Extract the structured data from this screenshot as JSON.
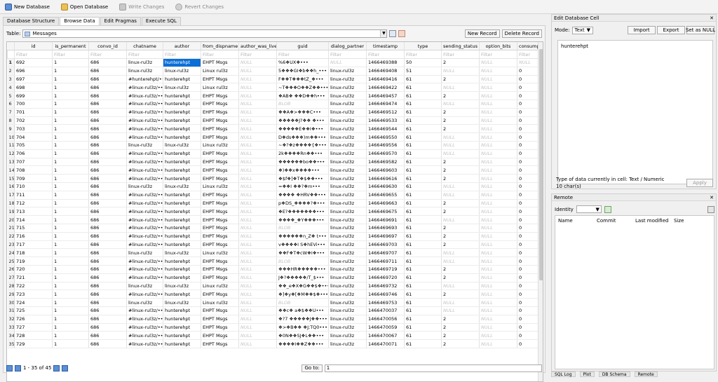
{
  "toolbar": {
    "new_db": "New Database",
    "open_db": "Open Database",
    "write": "Write Changes",
    "revert": "Revert Changes"
  },
  "tabs": [
    "Database Structure",
    "Browse Data",
    "Edit Pragmas",
    "Execute SQL"
  ],
  "browse": {
    "table_label": "Table:",
    "table_name": "Messages",
    "new_record": "New Record",
    "delete_record": "Delete Record",
    "filter_placeholder": "Filter",
    "columns": [
      "id",
      "is_permanent",
      "convo_id",
      "chatname",
      "author",
      "from_dispname",
      "author_was_live",
      "guid",
      "dialog_partner",
      "timestamp",
      "type",
      "sending_status",
      "option_bits",
      "consumpt"
    ],
    "rows": [
      [
        "1",
        "692",
        "1",
        "686",
        "linux-rul3z",
        "hunterehpt",
        "EHPT Msgs",
        "NULL",
        "%6❖UX❖•••",
        "NULL",
        "1466469388",
        "50",
        "2",
        "NULL",
        "NULL"
      ],
      [
        "2",
        "696",
        "1",
        "686",
        "linux-rul3z",
        "linux-rul3z",
        "Linux rul3z",
        "NULL",
        "5❖❖❖GI❖b❖❖h_•••",
        "linux-rul3z",
        "1466469408",
        "51",
        "NULL",
        "NULL",
        "0"
      ],
      [
        "3",
        "697",
        "1",
        "686",
        "#hunterehpt/•••",
        "hunterehpt",
        "EHPT Msgs",
        "NULL",
        "F❖❖T❖❖❖tZ_❖•••",
        "linux-rul3z",
        "1466469416",
        "61",
        "2",
        "NULL",
        "0"
      ],
      [
        "4",
        "698",
        "1",
        "686",
        "#linux-rul3z/•••",
        "linux-rul3z",
        "Linux rul3z",
        "NULL",
        "~T❖❖❖O❖❖Z❖❖•••",
        "linux-rul3z",
        "1466469422",
        "61",
        "NULL",
        "NULL",
        "0"
      ],
      [
        "5",
        "699",
        "1",
        "686",
        "#linux-rul3z/•••",
        "hunterehpt",
        "EHPT Msgs",
        "NULL",
        "❖AB❖ ❖❖D❖❖h•••",
        "linux-rul3z",
        "1466469457",
        "61",
        "2",
        "NULL",
        "0"
      ],
      [
        "6",
        "700",
        "1",
        "686",
        "#linux-rul3z/•••",
        "hunterehpt",
        "EHPT Msgs",
        "NULL",
        "BLOB",
        "linux-rul3z",
        "1466469474",
        "61",
        "NULL",
        "NULL",
        "0"
      ],
      [
        "7",
        "701",
        "1",
        "686",
        "#linux-rul3z/•••",
        "hunterehpt",
        "EHPT Msgs",
        "NULL",
        "❖❖A❖>❖❖❖C•••",
        "linux-rul3z",
        "1466469512",
        "61",
        "2",
        "NULL",
        "0"
      ],
      [
        "8",
        "702",
        "1",
        "686",
        "#linux-rul3z/•••",
        "hunterehpt",
        "EHPT Msgs",
        "NULL",
        "❖❖❖❖❖J?❖❖ ❖•••",
        "linux-rul3z",
        "1466469533",
        "61",
        "2",
        "NULL",
        "0"
      ],
      [
        "9",
        "703",
        "1",
        "686",
        "#linux-rul3z/•••",
        "hunterehpt",
        "EHPT Msgs",
        "NULL",
        "❖❖❖❖❖E❖❖I❖•••",
        "linux-rul3z",
        "1466469544",
        "61",
        "2",
        "NULL",
        "0"
      ],
      [
        "10",
        "704",
        "1",
        "686",
        "#linux-rul3z/•••",
        "hunterehpt",
        "EHPT Msgs",
        "NULL",
        "D❖ds❖❖❖)m❖❖•••",
        "linux-rul3z",
        "1466469550",
        "61",
        "NULL",
        "NULL",
        "0"
      ],
      [
        "11",
        "705",
        "1",
        "686",
        "linux-rul3z",
        "linux-rul3z",
        "Linux rul3z",
        "NULL",
        "~❖?❖z❖❖❖❖{❖•••",
        "linux-rul3z",
        "1466469556",
        "61",
        "NULL",
        "NULL",
        "0"
      ],
      [
        "12",
        "706",
        "1",
        "686",
        "#linux-rul3z/•••",
        "hunterehpt",
        "EHPT Msgs",
        "NULL",
        "2k❖❖❖❖Rn❖❖•••",
        "linux-rul3z",
        "1466469570",
        "61",
        "NULL",
        "NULL",
        "0"
      ],
      [
        "13",
        "707",
        "1",
        "686",
        "#linux-rul3z/•••",
        "hunterehpt",
        "EHPT Msgs",
        "NULL",
        "❖❖❖❖❖❖bo❖❖•••",
        "linux-rul3z",
        "1466469582",
        "61",
        "2",
        "NULL",
        "0"
      ],
      [
        "14",
        "708",
        "1",
        "686",
        "#linux-rul3z/•••",
        "hunterehpt",
        "EHPT Msgs",
        "NULL",
        "❖)❖❖x❖❖❖❖•••",
        "linux-rul3z",
        "1466469603",
        "61",
        "2",
        "NULL",
        "0"
      ],
      [
        "15",
        "709",
        "1",
        "686",
        "#linux-rul3z/•••",
        "hunterehpt",
        "EHPT Msgs",
        "NULL",
        "❖$f❖]❖T❖$❖❖•••",
        "linux-rul3z",
        "1466469616",
        "61",
        "2",
        "NULL",
        "0"
      ],
      [
        "16",
        "710",
        "1",
        "686",
        "linux-rul3z",
        "linux-rul3z",
        "Linux rul3z",
        "NULL",
        "=❖❖I ❖❖?❖m•••",
        "linux-rul3z",
        "1466469630",
        "61",
        "NULL",
        "NULL",
        "0"
      ],
      [
        "17",
        "711",
        "1",
        "686",
        "#linux-rul3z/•••",
        "hunterehpt",
        "EHPT Msgs",
        "NULL",
        "❖❖❖❖ ❖HRV❖❖•••",
        "linux-rul3z",
        "1466469655",
        "61",
        "NULL",
        "NULL",
        "0"
      ],
      [
        "18",
        "712",
        "1",
        "686",
        "#linux-rul3z/•••",
        "hunterehpt",
        "EHPT Msgs",
        "NULL",
        "p❖DS_❖❖❖❖?❖•••",
        "linux-rul3z",
        "1466469663",
        "61",
        "2",
        "NULL",
        "0"
      ],
      [
        "19",
        "713",
        "1",
        "686",
        "#linux-rul3z/•••",
        "hunterehpt",
        "EHPT Msgs",
        "NULL",
        "❖E?❖❖❖❖❖❖❖•••",
        "linux-rul3z",
        "1466469675",
        "61",
        "2",
        "NULL",
        "0"
      ],
      [
        "20",
        "714",
        "1",
        "686",
        "#linux-rul3z/•••",
        "hunterehpt",
        "EHPT Msgs",
        "NULL",
        "❖❖❖❖_❖Y❖❖❖•••",
        "linux-rul3z",
        "1466469691",
        "61",
        "NULL",
        "NULL",
        "0"
      ],
      [
        "21",
        "715",
        "1",
        "686",
        "#linux-rul3z/•••",
        "hunterehpt",
        "EHPT Msgs",
        "NULL",
        "BLOB",
        "linux-rul3z",
        "1466469693",
        "61",
        "2",
        "NULL",
        "0"
      ],
      [
        "22",
        "716",
        "1",
        "686",
        "#linux-rul3z/•••",
        "hunterehpt",
        "EHPT Msgs",
        "NULL",
        "❖❖❖❖❖❖n_Z❖ t•••",
        "linux-rul3z",
        "1466469697",
        "61",
        "2",
        "NULL",
        "0"
      ],
      [
        "23",
        "717",
        "1",
        "686",
        "#linux-rul3z/•••",
        "hunterehpt",
        "EHPT Msgs",
        "NULL",
        "v❖❖❖❖I S❖hEVi•••",
        "linux-rul3z",
        "1466469703",
        "61",
        "2",
        "NULL",
        "0"
      ],
      [
        "24",
        "718",
        "1",
        "686",
        "linux-rul3z",
        "linux-rul3z",
        "Linux rul3z",
        "NULL",
        "❖❖F❖T❖cW❖I❖•••",
        "linux-rul3z",
        "1466469707",
        "61",
        "NULL",
        "NULL",
        "0"
      ],
      [
        "25",
        "719",
        "1",
        "686",
        "#linux-rul3z/•••",
        "hunterehpt",
        "EHPT Msgs",
        "NULL",
        "BLOB",
        "linux-rul3z",
        "1466469711",
        "61",
        "NULL",
        "NULL",
        "0"
      ],
      [
        "26",
        "720",
        "1",
        "686",
        "#linux-rul3z/•••",
        "hunterehpt",
        "EHPT Msgs",
        "NULL",
        "❖❖❖HR❖❖❖❖❖•••",
        "linux-rul3z",
        "1466469719",
        "61",
        "2",
        "NULL",
        "0"
      ],
      [
        "27",
        "721",
        "1",
        "686",
        "#linux-rul3z/•••",
        "hunterehpt",
        "EHPT Msgs",
        "NULL",
        "J❖?❖❖❖❖❖/T_$•••",
        "linux-rul3z",
        "1466469720",
        "61",
        "2",
        "NULL",
        "0"
      ],
      [
        "28",
        "722",
        "1",
        "686",
        "linux-rul3z",
        "linux-rul3z",
        "Linux rul3z",
        "NULL",
        "❖❖_e❖X❖G❖❖$❖•••",
        "linux-rul3z",
        "1466469732",
        "61",
        "NULL",
        "NULL",
        "0"
      ],
      [
        "29",
        "723",
        "1",
        "686",
        "#linux-rul3z/•••",
        "hunterehpt",
        "EHPT Msgs",
        "NULL",
        "❖]❖y❖[❖M❖❖$❖•••",
        "linux-rul3z",
        "1466469746",
        "61",
        "2",
        "NULL",
        "0"
      ],
      [
        "30",
        "724",
        "1",
        "686",
        "linux-rul3z",
        "linux-rul3z",
        "Linux rul3z",
        "NULL",
        "BLOB",
        "linux-rul3z",
        "1466469753",
        "61",
        "NULL",
        "NULL",
        "0"
      ],
      [
        "31",
        "725",
        "1",
        "686",
        "#linux-rul3z/•••",
        "hunterehpt",
        "EHPT Msgs",
        "NULL",
        "❖❖c❖ a❖$❖❖U•••",
        "linux-rul3z",
        "1466470037",
        "61",
        "NULL",
        "NULL",
        "0"
      ],
      [
        "32",
        "726",
        "1",
        "686",
        "#linux-rul3z/•••",
        "hunterehpt",
        "EHPT Msgs",
        "NULL",
        "❖?7 ❖❖❖❖❖J❖❖•••",
        "linux-rul3z",
        "1466470056",
        "61",
        "2",
        "NULL",
        "0"
      ],
      [
        "33",
        "727",
        "1",
        "686",
        "#linux-rul3z/•••",
        "hunterehpt",
        "EHPT Msgs",
        "NULL",
        "❖>❖B❖❖ ❖J;TQ0•••",
        "linux-rul3z",
        "1466470059",
        "61",
        "2",
        "NULL",
        "0"
      ],
      [
        "34",
        "728",
        "1",
        "686",
        "#linux-rul3z/•••",
        "hunterehpt",
        "EHPT Msgs",
        "NULL",
        "❖0N❖❖SJ❖L❖❖•••",
        "linux-rul3z",
        "1466470067",
        "61",
        "2",
        "NULL",
        "0"
      ],
      [
        "35",
        "729",
        "1",
        "686",
        "#linux-rul3z/•••",
        "hunterehpt",
        "EHPT Msgs",
        "NULL",
        "❖❖❖❖I❖❖Z❖❖•••",
        "linux-rul3z",
        "1466470071",
        "61",
        "2",
        "NULL",
        "0"
      ]
    ],
    "selected": {
      "row": 0,
      "col": 5
    },
    "record_info": "1 - 35 of 45",
    "goto_label": "Go to:",
    "goto_value": "1"
  },
  "edit_cell": {
    "title": "Edit Database Cell",
    "mode_label": "Mode:",
    "mode_value": "Text",
    "import": "Import",
    "export": "Export",
    "set_null": "Set as NULL",
    "content": "hunterehpt",
    "type_info": "Type of data currently in cell: Text / Numeric",
    "chars_info": "10 char(s)",
    "apply": "Apply"
  },
  "remote": {
    "title": "Remote",
    "identity_label": "Identity",
    "columns": [
      "Name",
      "Commit",
      "Last modified",
      "Size"
    ]
  },
  "bottom_tabs": [
    "SQL Log",
    "Plot",
    "DB Schema",
    "Remote"
  ]
}
